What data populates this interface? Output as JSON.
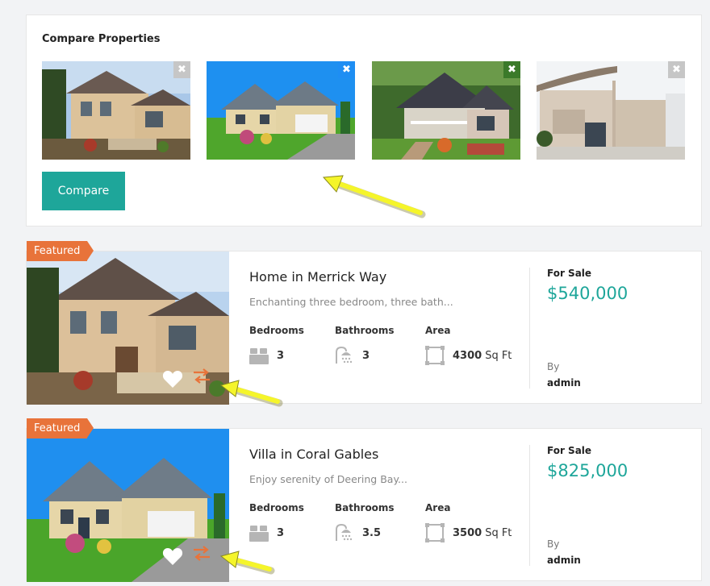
{
  "compare": {
    "title": "Compare Properties",
    "button_label": "Compare",
    "thumbs": [
      {
        "close_icon": "close-icon",
        "close_color": "#c6c6c6"
      },
      {
        "close_icon": "close-icon",
        "close_color": "#1e8ef3"
      },
      {
        "close_icon": "close-icon",
        "close_color": "#3b7a2a"
      },
      {
        "close_icon": "close-icon",
        "close_color": "#c6c6c6"
      }
    ]
  },
  "listings": [
    {
      "badge": "Featured",
      "title": "Home in Merrick Way",
      "description": "Enchanting three bedroom, three bath...",
      "bedrooms_label": "Bedrooms",
      "bedrooms": "3",
      "bathrooms_label": "Bathrooms",
      "bathrooms": "3",
      "area_label": "Area",
      "area_value": "4300",
      "area_unit": "Sq Ft",
      "status": "For Sale",
      "price": "$540,000",
      "by_label": "By",
      "author": "admin"
    },
    {
      "badge": "Featured",
      "title": "Villa in Coral Gables",
      "description": "Enjoy serenity of Deering Bay...",
      "bedrooms_label": "Bedrooms",
      "bedrooms": "3",
      "bathrooms_label": "Bathrooms",
      "bathrooms": "3.5",
      "area_label": "Area",
      "area_value": "3500",
      "area_unit": "Sq Ft",
      "status": "For Sale",
      "price": "$825,000",
      "by_label": "By",
      "author": "admin"
    }
  ],
  "colors": {
    "accent": "#1ea69a",
    "featured_badge": "#e8733a",
    "compare_arrows": "#e8733a",
    "annotation_arrow": "#f5f52a"
  }
}
